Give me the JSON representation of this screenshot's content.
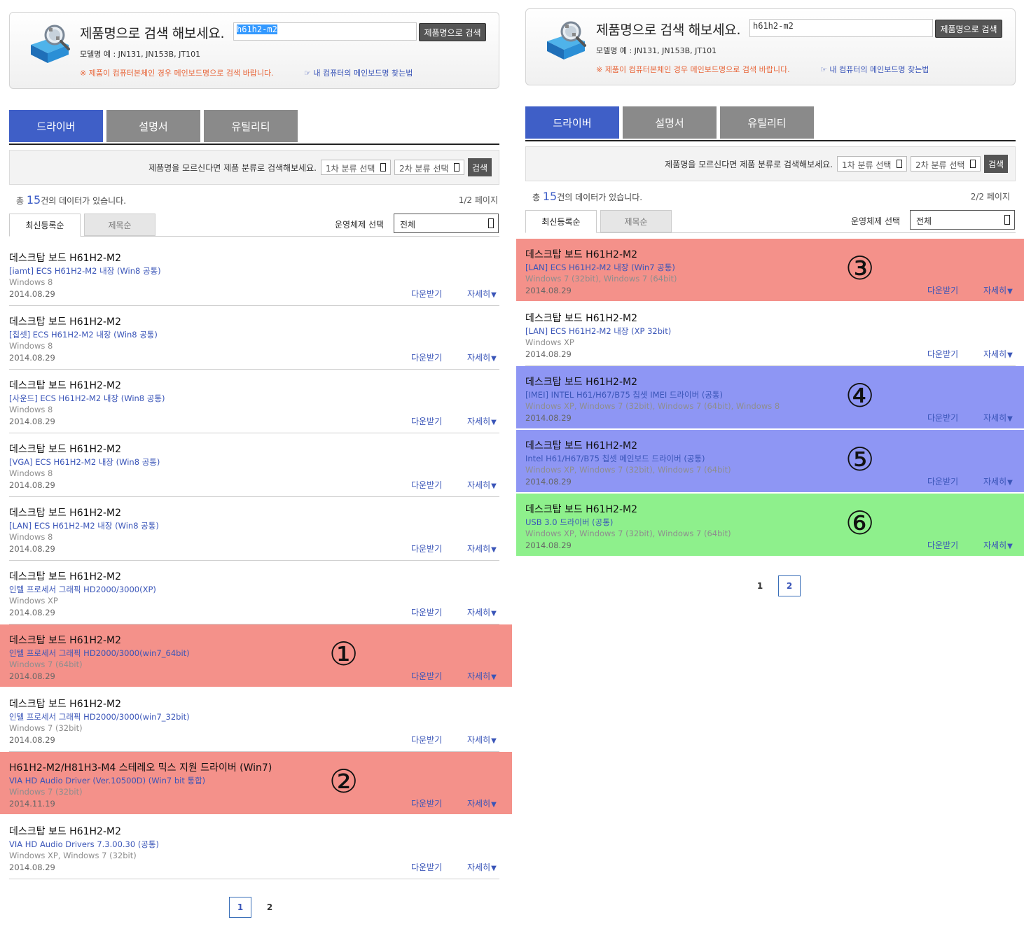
{
  "search": {
    "title": "제품명으로 검색 해보세요.",
    "button": "제품명으로 검색",
    "model_hint": "모델명 예 : JN131, JN153B, JT101",
    "notice": "※ 제품이 컴퓨터본체인 경우 메인보드명으로 검색 바랍니다.",
    "find_link": "내 컴퓨터의 메인보드명 찾는법"
  },
  "tabs": [
    "드라이버",
    "설명서",
    "유틸리티"
  ],
  "category": {
    "text": "제품명을 모르신다면 제품 분류로 검색해보세요.",
    "first": "1차 분류 선택",
    "second": "2차 분류 선택",
    "button": "검색"
  },
  "count": {
    "prefix": "총",
    "number": "15",
    "suffix": "건의 데이터가 있습니다."
  },
  "sort_tabs": [
    "최신등록순",
    "제목순"
  ],
  "os_filter": {
    "label": "운영체제 선택",
    "value": "전체"
  },
  "labels": {
    "download": "다운받기",
    "detail": "자세히",
    "caret": "▼"
  },
  "highlight_colors": {
    "red": "#f4918a",
    "blue": "#8e96f4",
    "green": "#8ef08c"
  },
  "left": {
    "search_value": "h61h2-m2",
    "page_label": "1/2 페이지",
    "rows": [
      {
        "title": "데스크탑 보드 H61H2-M2",
        "driver": "[iamt] ECS H61H2-M2 내장 (Win8 공통)",
        "os": "Windows 8",
        "date": "2014.08.29"
      },
      {
        "title": "데스크탑 보드 H61H2-M2",
        "driver": "[칩셋] ECS H61H2-M2 내장 (Win8 공통)",
        "os": "Windows 8",
        "date": "2014.08.29"
      },
      {
        "title": "데스크탑 보드 H61H2-M2",
        "driver": "[사운드] ECS H61H2-M2 내장 (Win8 공통)",
        "os": "Windows 8",
        "date": "2014.08.29"
      },
      {
        "title": "데스크탑 보드 H61H2-M2",
        "driver": "[VGA] ECS H61H2-M2 내장 (Win8 공통)",
        "os": "Windows 8",
        "date": "2014.08.29"
      },
      {
        "title": "데스크탑 보드 H61H2-M2",
        "driver": "[LAN] ECS H61H2-M2 내장 (Win8 공통)",
        "os": "Windows 8",
        "date": "2014.08.29"
      },
      {
        "title": "데스크탑 보드 H61H2-M2",
        "driver": "인텔 프로세서 그래픽 HD2000/3000(XP)",
        "os": "Windows XP",
        "date": "2014.08.29"
      },
      {
        "title": "데스크탑 보드 H61H2-M2",
        "driver": "인텔 프로세서 그래픽 HD2000/3000(win7_64bit)",
        "os": "Windows 7 (64bit)",
        "date": "2014.08.29",
        "highlight": "red",
        "marker": "①"
      },
      {
        "title": "데스크탑 보드 H61H2-M2",
        "driver": "인텔 프로세서 그래픽 HD2000/3000(win7_32bit)",
        "os": "Windows 7 (32bit)",
        "date": "2014.08.29"
      },
      {
        "title": "H61H2-M2/H81H3-M4 스테레오 믹스 지원 드라이버 (Win7)",
        "driver": "VIA HD Audio Driver (Ver.10500D) (Win7 bit 통합)",
        "os": "Windows 7 (32bit)",
        "date": "2014.11.19",
        "highlight": "red",
        "marker": "②"
      },
      {
        "title": "데스크탑 보드 H61H2-M2",
        "driver": "VIA HD Audio Drivers 7.3.00.30 (공통)",
        "os": "Windows XP, Windows 7 (32bit)",
        "date": "2014.08.29"
      }
    ],
    "pages": [
      "1",
      "2"
    ],
    "current_page": "1"
  },
  "right": {
    "search_value": "h61h2-m2",
    "page_label": "2/2 페이지",
    "rows": [
      {
        "title": "데스크탑 보드 H61H2-M2",
        "driver": "[LAN] ECS H61H2-M2 내장 (Win7 공통)",
        "os": "Windows 7 (32bit), Windows 7 (64bit)",
        "date": "2014.08.29",
        "highlight": "red",
        "marker": "③"
      },
      {
        "title": "데스크탑 보드 H61H2-M2",
        "driver": "[LAN] ECS H61H2-M2 내장 (XP 32bit)",
        "os": "Windows XP",
        "date": "2014.08.29"
      },
      {
        "title": "데스크탑 보드 H61H2-M2",
        "driver": "[IMEI] INTEL H61/H67/B75 칩셋 IMEI 드라이버 (공통)",
        "os": "Windows XP, Windows 7 (32bit), Windows 7 (64bit), Windows 8",
        "date": "2014.08.29",
        "highlight": "blue",
        "marker": "④"
      },
      {
        "title": "데스크탑 보드 H61H2-M2",
        "driver": "Intel H61/H67/B75 칩셋 메인보드 드라이버 (공통)",
        "os": "Windows XP, Windows 7 (32bit), Windows 7 (64bit)",
        "date": "2014.08.29",
        "highlight": "blue",
        "marker": "⑤"
      },
      {
        "title": "데스크탑 보드 H61H2-M2",
        "driver": "USB 3.0 드라이버 (공통)",
        "os": "Windows XP, Windows 7 (32bit), Windows 7 (64bit)",
        "date": "2014.08.29",
        "highlight": "green",
        "marker": "⑥"
      }
    ],
    "pages": [
      "1",
      "2"
    ],
    "current_page": "2"
  }
}
